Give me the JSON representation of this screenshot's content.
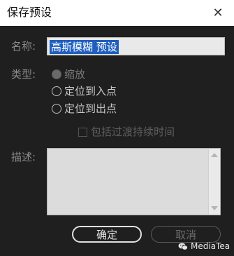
{
  "window": {
    "title": "保存预设",
    "close_glyph": "✕"
  },
  "form": {
    "name_label": "名称:",
    "name_value": "高斯模糊 预设",
    "type_label": "类型:",
    "type_options": [
      {
        "label": "缩放",
        "enabled": false
      },
      {
        "label": "定位到入点",
        "enabled": true
      },
      {
        "label": "定位到出点",
        "enabled": true
      }
    ],
    "include_transitions_label": "包括过渡持续时间",
    "description_label": "描述:",
    "description_value": ""
  },
  "buttons": {
    "ok_label": "确定",
    "cancel_label": "取消"
  },
  "watermark": {
    "text": "MediaTea",
    "icon": "wechat-icon"
  }
}
